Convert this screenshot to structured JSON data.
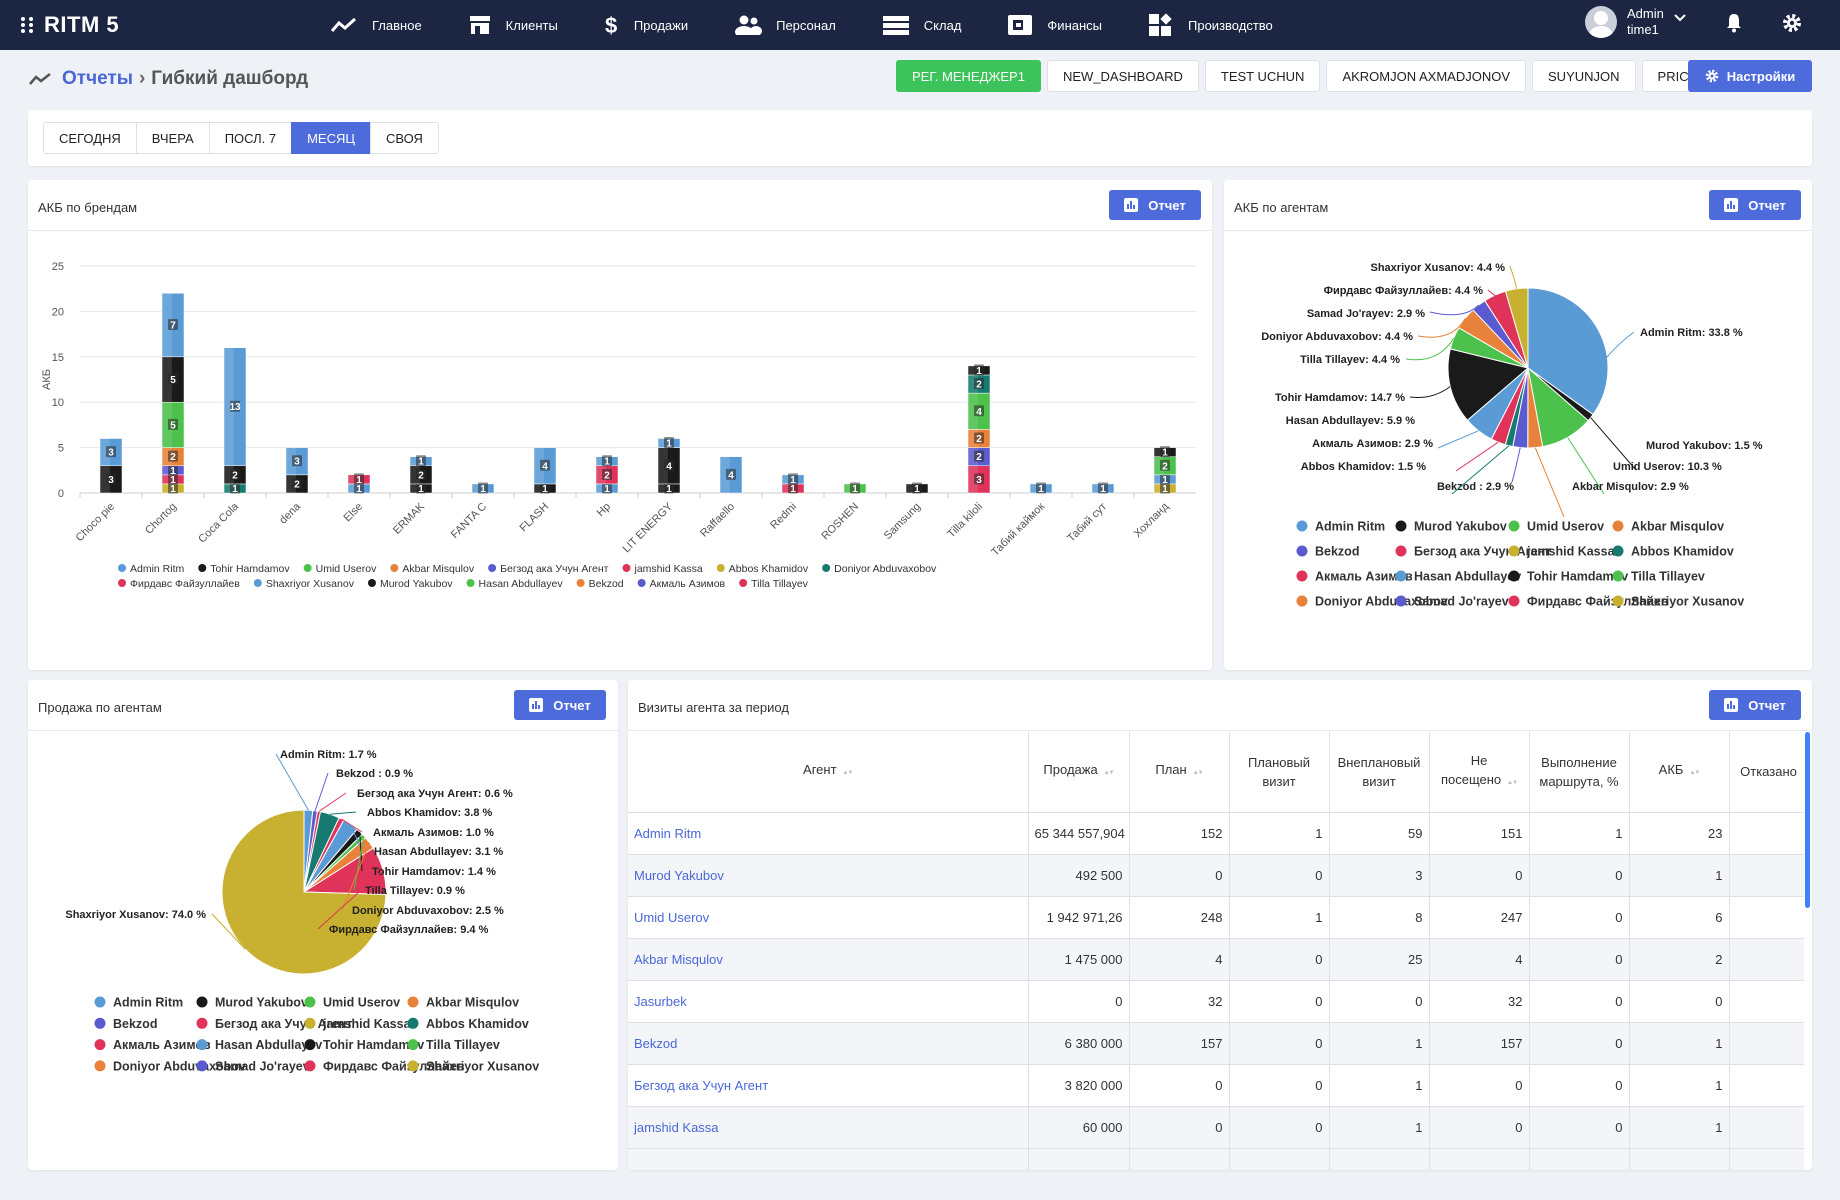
{
  "app": {
    "title": "RITM 5"
  },
  "nav": [
    {
      "label": "Главное",
      "icon": "trend-line-icon"
    },
    {
      "label": "Клиенты",
      "icon": "store-icon"
    },
    {
      "label": "Продажи",
      "icon": "dollar-icon"
    },
    {
      "label": "Персонал",
      "icon": "people-icon"
    },
    {
      "label": "Склад",
      "icon": "warehouse-icon"
    },
    {
      "label": "Финансы",
      "icon": "finance-icon"
    },
    {
      "label": "Производство",
      "icon": "production-icon"
    }
  ],
  "user": {
    "name": "Admin",
    "sub": "time1"
  },
  "breadcrumb": {
    "root": "Отчеты",
    "sep": "›",
    "current": "Гибкий дашборд"
  },
  "dashboard_tabs": [
    "РЕГ. МЕНЕДЖЕР1",
    "NEW_DASHBOARD",
    "TEST UCHUN",
    "AKROMJON AXMADJONOV",
    "SUYUNJON",
    "PRICE LIST"
  ],
  "active_dashboard_tab": 0,
  "settings_label": "Настройки",
  "periods": [
    "СЕГОДНЯ",
    "ВЧЕРА",
    "ПОСЛ. 7",
    "МЕСЯЦ",
    "СВОЯ"
  ],
  "active_period": 3,
  "report_label": "Отчет",
  "colors": {
    "Admin Ritm": "#5b9bd5",
    "Tohir Hamdamov": "#1a1a1a",
    "Umid Userov": "#4cc14c",
    "Akbar Misqulov": "#e8813a",
    "Бегзод ака Учун Агент": "#5b5bd0",
    "jamshid Kassa": "#e0335a",
    "Abbos Khamidov": "#c8b030",
    "Doniyor Abduvaxobov": "#167a70",
    "Фирдавс Файзуллайев": "#e0335a",
    "Shaxriyor Xusanov": "#5b9bd5",
    "Murod Yakubov": "#1a1a1a",
    "Hasan Abdullayev": "#4cc14c",
    "Bekzod": "#e8813a",
    "Акмаль Азимов": "#5b5bd0",
    "Tilla Tillayev": "#e0335a"
  },
  "akb_brands": {
    "title": "АКБ по брендам",
    "chart_data": {
      "type": "bar",
      "stacked": true,
      "ylabel": "АКБ",
      "ylim": [
        0,
        25
      ],
      "yticks": [
        0,
        5,
        10,
        15,
        20,
        25
      ],
      "categories": [
        "Choco pie",
        "Chortog",
        "Coca Cola",
        "dena",
        "Else",
        "ERMAK",
        "FANTA C",
        "FLASH",
        "Hp",
        "LIT ENERGY",
        "Raffaello",
        "Redmi",
        "ROSHEN",
        "Samsung",
        "Tilla kiloli",
        "Табий каймок",
        "Табий сут",
        "Хохланд"
      ],
      "stacks": [
        [
          {
            "s": "Tohir Hamdamov",
            "v": 3
          },
          {
            "s": "Admin Ritm",
            "v": 3
          }
        ],
        [
          {
            "s": "Abbos Khamidov",
            "v": 1
          },
          {
            "s": "jamshid Kassa",
            "v": 1
          },
          {
            "s": "Бегзод ака Учун Агент",
            "v": 1
          },
          {
            "s": "Akbar Misqulov",
            "v": 2
          },
          {
            "s": "Umid Userov",
            "v": 5
          },
          {
            "s": "Tohir Hamdamov",
            "v": 5
          },
          {
            "s": "Admin Ritm",
            "v": 7
          }
        ],
        [
          {
            "s": "Doniyor Abduvaxobov",
            "v": 1
          },
          {
            "s": "Tohir Hamdamov",
            "v": 2
          },
          {
            "s": "Admin Ritm",
            "v": 13
          }
        ],
        [
          {
            "s": "Tohir Hamdamov",
            "v": 2
          },
          {
            "s": "Admin Ritm",
            "v": 3
          }
        ],
        [
          {
            "s": "Admin Ritm",
            "v": 1
          },
          {
            "s": "jamshid Kassa",
            "v": 1
          }
        ],
        [
          {
            "s": "Tohir Hamdamov",
            "v": 1
          },
          {
            "s": "Tohir Hamdamov",
            "v": 2
          },
          {
            "s": "Admin Ritm",
            "v": 1
          }
        ],
        [
          {
            "s": "Admin Ritm",
            "v": 1
          }
        ],
        [
          {
            "s": "Tohir Hamdamov",
            "v": 1
          },
          {
            "s": "Admin Ritm",
            "v": 4
          }
        ],
        [
          {
            "s": "Admin Ritm",
            "v": 1
          },
          {
            "s": "jamshid Kassa",
            "v": 2
          },
          {
            "s": "Admin Ritm",
            "v": 1
          }
        ],
        [
          {
            "s": "Tohir Hamdamov",
            "v": 1
          },
          {
            "s": "Tohir Hamdamov",
            "v": 4
          },
          {
            "s": "Admin Ritm",
            "v": 1
          }
        ],
        [
          {
            "s": "Admin Ritm",
            "v": 0
          },
          {
            "s": "Admin Ritm",
            "v": 4
          }
        ],
        [
          {
            "s": "jamshid Kassa",
            "v": 1
          },
          {
            "s": "Admin Ritm",
            "v": 1
          }
        ],
        [
          {
            "s": "Umid Userov",
            "v": 1
          }
        ],
        [
          {
            "s": "Tohir Hamdamov",
            "v": 1
          }
        ],
        [
          {
            "s": "jamshid Kassa",
            "v": 3
          },
          {
            "s": "Бегзод ака Учун Агент",
            "v": 2
          },
          {
            "s": "Akbar Misqulov",
            "v": 2
          },
          {
            "s": "Umid Userov",
            "v": 4
          },
          {
            "s": "Doniyor Abduvaxobov",
            "v": 2
          },
          {
            "s": "Tohir Hamdamov",
            "v": 1
          }
        ],
        [
          {
            "s": "Admin Ritm",
            "v": 1
          }
        ],
        [
          {
            "s": "Admin Ritm",
            "v": 1
          }
        ],
        [
          {
            "s": "Abbos Khamidov",
            "v": 1
          },
          {
            "s": "Admin Ritm",
            "v": 1
          },
          {
            "s": "Umid Userov",
            "v": 2
          },
          {
            "s": "Tohir Hamdamov",
            "v": 1
          }
        ]
      ],
      "legend": [
        "Admin Ritm",
        "Tohir Hamdamov",
        "Umid Userov",
        "Akbar Misqulov",
        "Бегзод ака Учун Агент",
        "jamshid Kassa",
        "Abbos Khamidov",
        "Doniyor Abduvaxobov",
        "Фирдавс Файзуллайев",
        "Shaxriyor Xusanov",
        "Murod Yakubov",
        "Hasan Abdullayev",
        "Bekzod",
        "Акмаль Азимов",
        "Tilla Tillayev"
      ]
    }
  },
  "pie_colors": [
    "#5b9bd5",
    "#1a1a1a",
    "#4cc14c",
    "#e8813a",
    "#5b5bd0",
    "#e0335a",
    "#c8b030",
    "#167a70",
    "#e0335a",
    "#5b9bd5",
    "#1a1a1a",
    "#4cc14c",
    "#e8813a",
    "#5b5bd0",
    "#e0335a",
    "#c8b030"
  ],
  "legend_names": [
    "Admin Ritm",
    "Murod Yakubov",
    "Umid Userov",
    "Akbar Misqulov",
    "Bekzod",
    "Бегзод ака Учун Агент",
    "jamshid Kassa",
    "Abbos Khamidov",
    "Акмаль Азимов",
    "Hasan Abdullayev",
    "Tohir Hamdamov",
    "Tilla Tillayev",
    "Doniyor Abduvaxobov",
    "Samad Jo'rayev",
    "Фирдавс Файзуллайев",
    "Shaxriyor Xusanov"
  ],
  "akb_agents": {
    "title": "АКБ по агентам",
    "chart_data": {
      "type": "pie",
      "slices": [
        {
          "label": "Admin Ritm: 33.8 %",
          "value": 33.8,
          "ci": 0
        },
        {
          "label": "Murod Yakubov: 1.5 %",
          "value": 1.5,
          "ci": 1
        },
        {
          "label": "Umid Userov: 10.3 %",
          "value": 10.3,
          "ci": 2
        },
        {
          "label": "Akbar Misqulov: 2.9 %",
          "value": 2.9,
          "ci": 3
        },
        {
          "label": "Bekzod : 2.9 %",
          "value": 2.9,
          "ci": 4
        },
        {
          "label": "Abbos Khamidov: 1.5 %",
          "value": 1.5,
          "ci": 7
        },
        {
          "label": "Акмаль Азимов: 2.9 %",
          "value": 2.9,
          "ci": 8
        },
        {
          "label": "Hasan Abdullayev: 5.9 %",
          "value": 5.9,
          "ci": 9
        },
        {
          "label": "Tohir Hamdamov: 14.7 %",
          "value": 14.7,
          "ci": 10
        },
        {
          "label": "Tilla Tillayev: 4.4 %",
          "value": 4.4,
          "ci": 11
        },
        {
          "label": "Doniyor Abduvaxobov: 4.4 %",
          "value": 4.4,
          "ci": 12
        },
        {
          "label": "Samad Jo'rayev: 2.9 %",
          "value": 2.9,
          "ci": 13
        },
        {
          "label": "Фирдавс Файзуллайев: 4.4 %",
          "value": 4.4,
          "ci": 14
        },
        {
          "label": "Shaxriyor Xusanov: 4.4 %",
          "value": 4.4,
          "ci": 15
        }
      ]
    }
  },
  "sales_agents": {
    "title": "Продажа по агентам",
    "chart_data": {
      "type": "pie",
      "slices": [
        {
          "label": "Admin Ritm: 1.7 %",
          "value": 1.7,
          "ci": 0
        },
        {
          "label": "Bekzod : 0.9 %",
          "value": 0.9,
          "ci": 4
        },
        {
          "label": "Бегзод ака Учун Агент: 0.6 %",
          "value": 0.6,
          "ci": 5
        },
        {
          "label": "Abbos Khamidov: 3.8 %",
          "value": 3.8,
          "ci": 7
        },
        {
          "label": "Акмаль Азимов: 1.0 %",
          "value": 1.0,
          "ci": 8
        },
        {
          "label": "Hasan Abdullayev: 3.1 %",
          "value": 3.1,
          "ci": 9
        },
        {
          "label": "Tohir Hamdamov: 1.4 %",
          "value": 1.4,
          "ci": 10
        },
        {
          "label": "Tilla Tillayev: 0.9 %",
          "value": 0.9,
          "ci": 11
        },
        {
          "label": "Doniyor Abduvaxobov: 2.5 %",
          "value": 2.5,
          "ci": 12
        },
        {
          "label": "Фирдавс Файзуллайев: 9.4 %",
          "value": 9.4,
          "ci": 14
        },
        {
          "label": "Shaxriyor Xusanov: 74.0 %",
          "value": 74.0,
          "ci": 15
        }
      ]
    }
  },
  "visits": {
    "title": "Визиты агента за период",
    "columns": [
      "Агент",
      "Продажа",
      "План",
      "Плановый визит",
      "Внеплановый визит",
      "Не посещено",
      "Выполнение маршрута, %",
      "АКБ",
      "Отказано"
    ],
    "rows": [
      [
        "Admin Ritm",
        "65 344 557,904",
        "152",
        "1",
        "59",
        "151",
        "1",
        "23",
        ""
      ],
      [
        "Murod Yakubov",
        "492 500",
        "0",
        "0",
        "3",
        "0",
        "0",
        "1",
        ""
      ],
      [
        "Umid Userov",
        "1 942 971,26",
        "248",
        "1",
        "8",
        "247",
        "0",
        "6",
        ""
      ],
      [
        "Akbar Misqulov",
        "1 475 000",
        "4",
        "0",
        "25",
        "4",
        "0",
        "2",
        ""
      ],
      [
        "Jasurbek",
        "0",
        "32",
        "0",
        "0",
        "32",
        "0",
        "0",
        ""
      ],
      [
        "Bekzod",
        "6 380 000",
        "157",
        "0",
        "1",
        "157",
        "0",
        "1",
        ""
      ],
      [
        "Бегзод ака Учун Агент",
        "3 820 000",
        "0",
        "0",
        "1",
        "0",
        "0",
        "1",
        ""
      ],
      [
        "jamshid Kassa",
        "60 000",
        "0",
        "0",
        "1",
        "0",
        "0",
        "1",
        ""
      ]
    ]
  }
}
